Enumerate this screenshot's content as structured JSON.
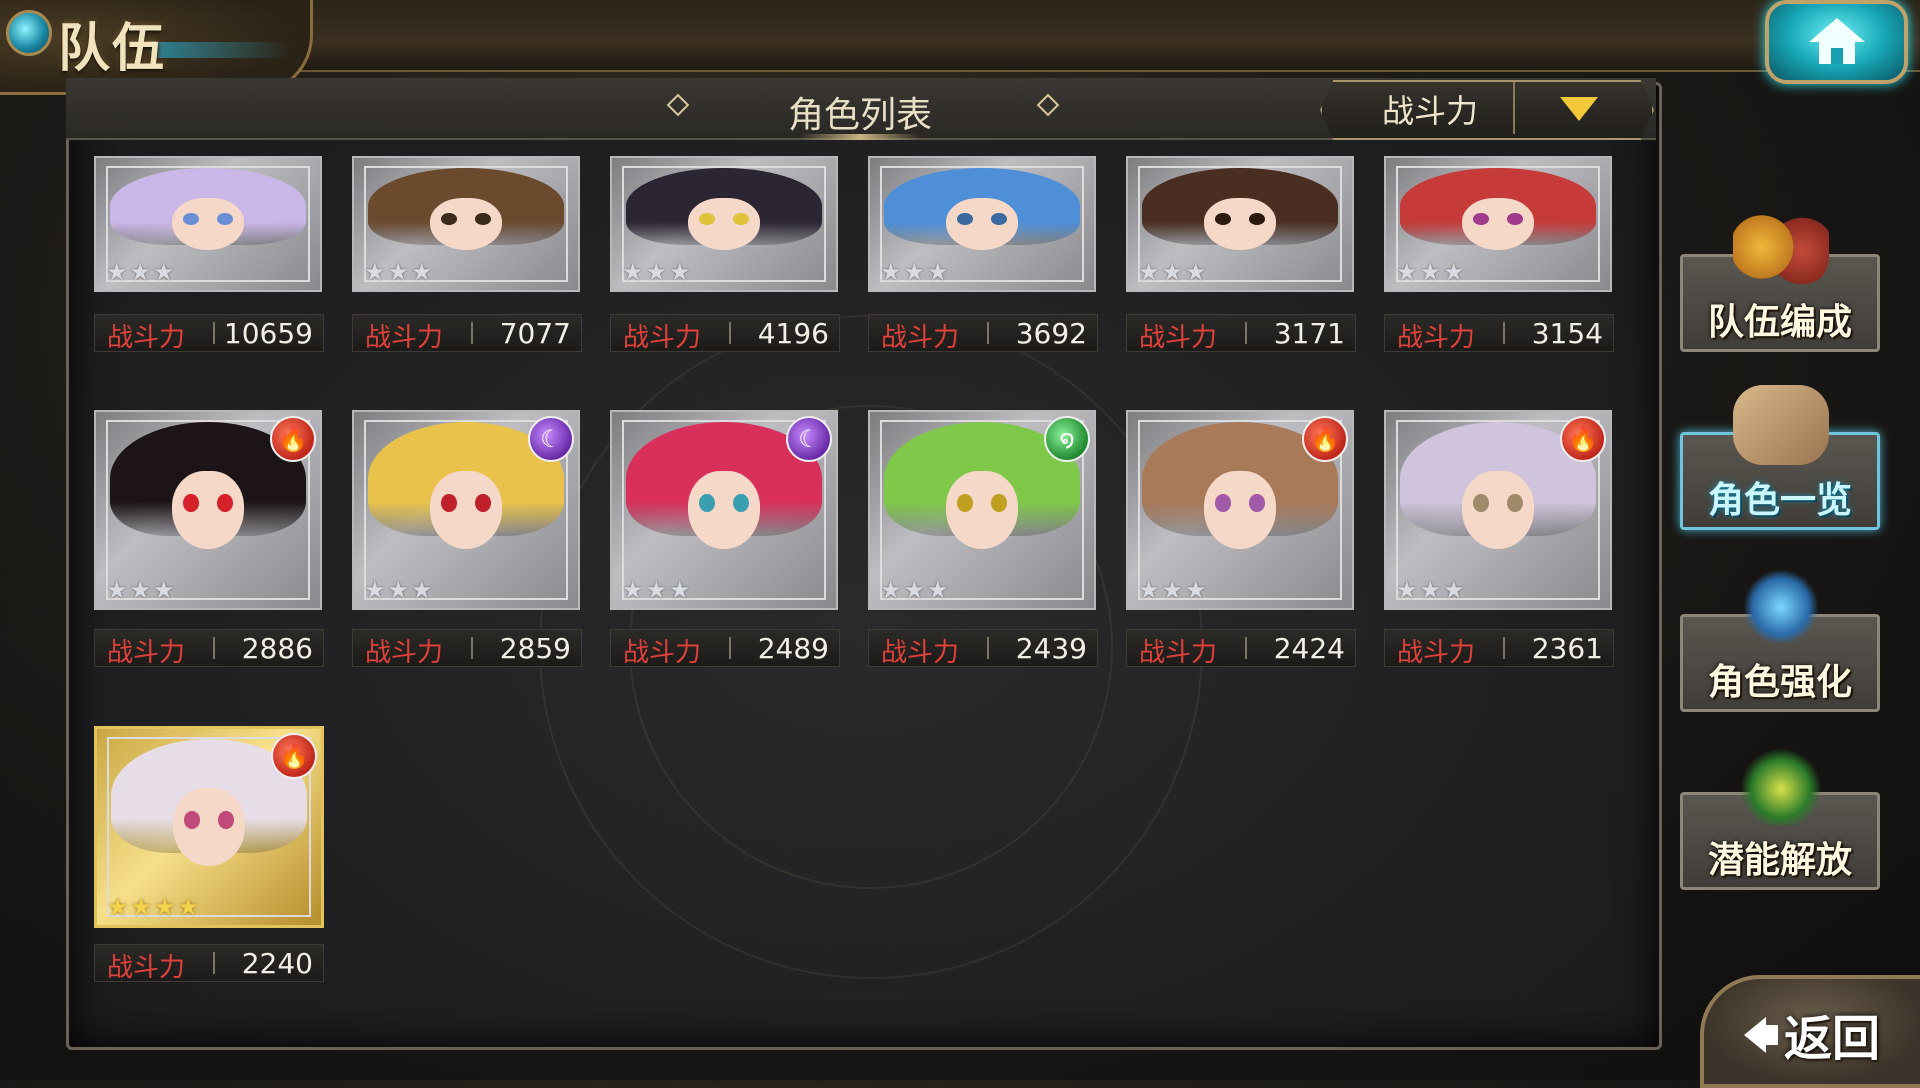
{
  "title": "队伍",
  "panel": {
    "title": "角色列表"
  },
  "sort": {
    "label": "战斗力"
  },
  "power_label": "战斗力",
  "characters": [
    {
      "power": "10659",
      "stars": 3,
      "element": "",
      "hair": "#cbb6e8",
      "eyes": "#6a8fd6",
      "rarity": "silver"
    },
    {
      "power": "7077",
      "stars": 3,
      "element": "",
      "hair": "#6b4a2e",
      "eyes": "#3a2a1a",
      "rarity": "silver"
    },
    {
      "power": "4196",
      "stars": 3,
      "element": "",
      "hair": "#2c2534",
      "eyes": "#e0c23a",
      "rarity": "silver"
    },
    {
      "power": "3692",
      "stars": 3,
      "element": "",
      "hair": "#4f8fd8",
      "eyes": "#3a6aa0",
      "rarity": "silver"
    },
    {
      "power": "3171",
      "stars": 3,
      "element": "",
      "hair": "#4a2e22",
      "eyes": "#2a1a10",
      "rarity": "silver"
    },
    {
      "power": "3154",
      "stars": 3,
      "element": "",
      "hair": "#c73a3a",
      "eyes": "#a03a8a",
      "rarity": "silver"
    },
    {
      "power": "2886",
      "stars": 3,
      "element": "fire",
      "hair": "#1c1416",
      "eyes": "#d6202a",
      "rarity": "silver"
    },
    {
      "power": "2859",
      "stars": 3,
      "element": "dark",
      "hair": "#e8c24a",
      "eyes": "#c0202a",
      "rarity": "silver"
    },
    {
      "power": "2489",
      "stars": 3,
      "element": "dark",
      "hair": "#d8305a",
      "eyes": "#3aa0b0",
      "rarity": "silver"
    },
    {
      "power": "2439",
      "stars": 3,
      "element": "wind",
      "hair": "#7fc84a",
      "eyes": "#c0a020",
      "rarity": "silver"
    },
    {
      "power": "2424",
      "stars": 3,
      "element": "fire",
      "hair": "#a87a5a",
      "eyes": "#a05aa8",
      "rarity": "silver"
    },
    {
      "power": "2361",
      "stars": 3,
      "element": "fire",
      "hair": "#cfc4dc",
      "eyes": "#a08a6a",
      "rarity": "silver"
    },
    {
      "power": "2240",
      "stars": 4,
      "element": "fire",
      "hair": "#e6dde6",
      "eyes": "#c04a7a",
      "rarity": "gold"
    }
  ],
  "menu": [
    {
      "label": "队伍编成",
      "active": false
    },
    {
      "label": "角色一览",
      "active": true
    },
    {
      "label": "角色强化",
      "active": false
    },
    {
      "label": "潜能解放",
      "active": false
    }
  ],
  "back_label": "返回",
  "icons": {
    "home": "home-icon",
    "sort_dropdown": "chevron-down-icon",
    "back": "arrow-left-icon",
    "elements": {
      "fire": "fire-element-icon",
      "dark": "moon-element-icon",
      "wind": "wind-element-icon"
    }
  },
  "colors": {
    "power_label": "#e0413a",
    "sort_arrow": "#f3c93a",
    "active_menu": "#6fc6dc"
  }
}
